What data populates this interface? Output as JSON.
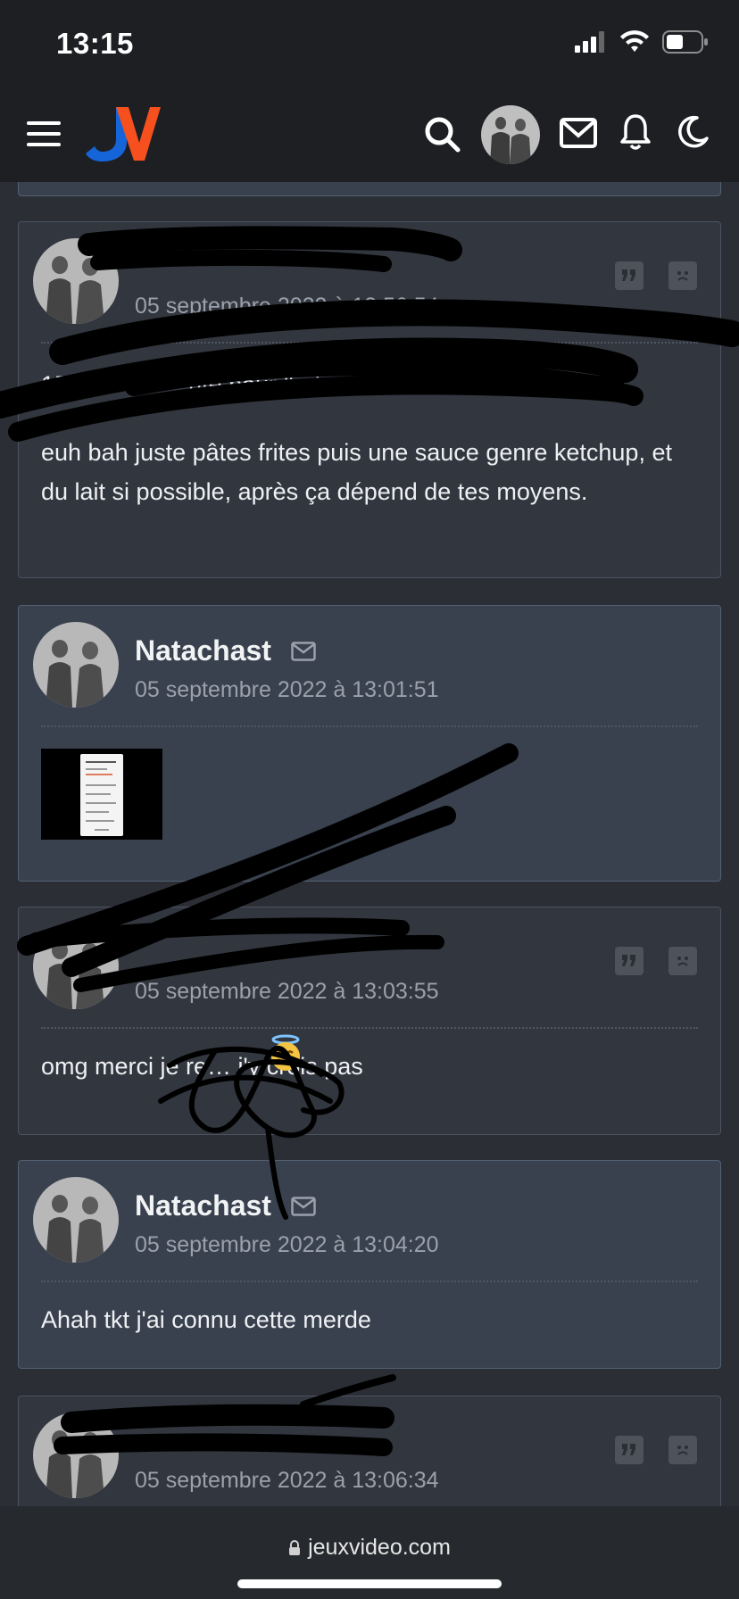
{
  "status_bar": {
    "time": "13:15"
  },
  "header": {
    "logo_text": "JV",
    "icons": [
      "menu-icon",
      "search-icon",
      "avatar",
      "mail-icon",
      "bell-icon",
      "moon-icon"
    ]
  },
  "posts": [
    {
      "author": "",
      "date": "05 septembre 2022 à 12:56:54",
      "text_partial": "156",
      "text_partial_2": "ute pour l'adresse",
      "text": "euh bah juste pâtes frites puis une sauce genre ketchup, et du lait si possible, après ça dépend de tes moyens."
    },
    {
      "author": "Natachast",
      "date": "05 septembre 2022 à 13:01:51"
    },
    {
      "author": "",
      "date": "05 septembre 2022 à 13:03:55",
      "text": "omg merci je re… j'y crois pas"
    },
    {
      "author": "Natachast",
      "date": "05 septembre 2022 à 13:04:20",
      "text": "Ahah tkt j'ai connu cette merde"
    },
    {
      "author": "",
      "date": "05 septembre 2022 à 13:06:34"
    }
  ],
  "thumbnail": {
    "title": "Commande en cours"
  },
  "bottom_bar": {
    "url": "jeuxvideo.com"
  },
  "colors": {
    "bg": "#2b2e35",
    "card": "#32363e",
    "card_alt": "#39414e",
    "logo_blue": "#1565d8",
    "logo_orange": "#f5501e"
  }
}
